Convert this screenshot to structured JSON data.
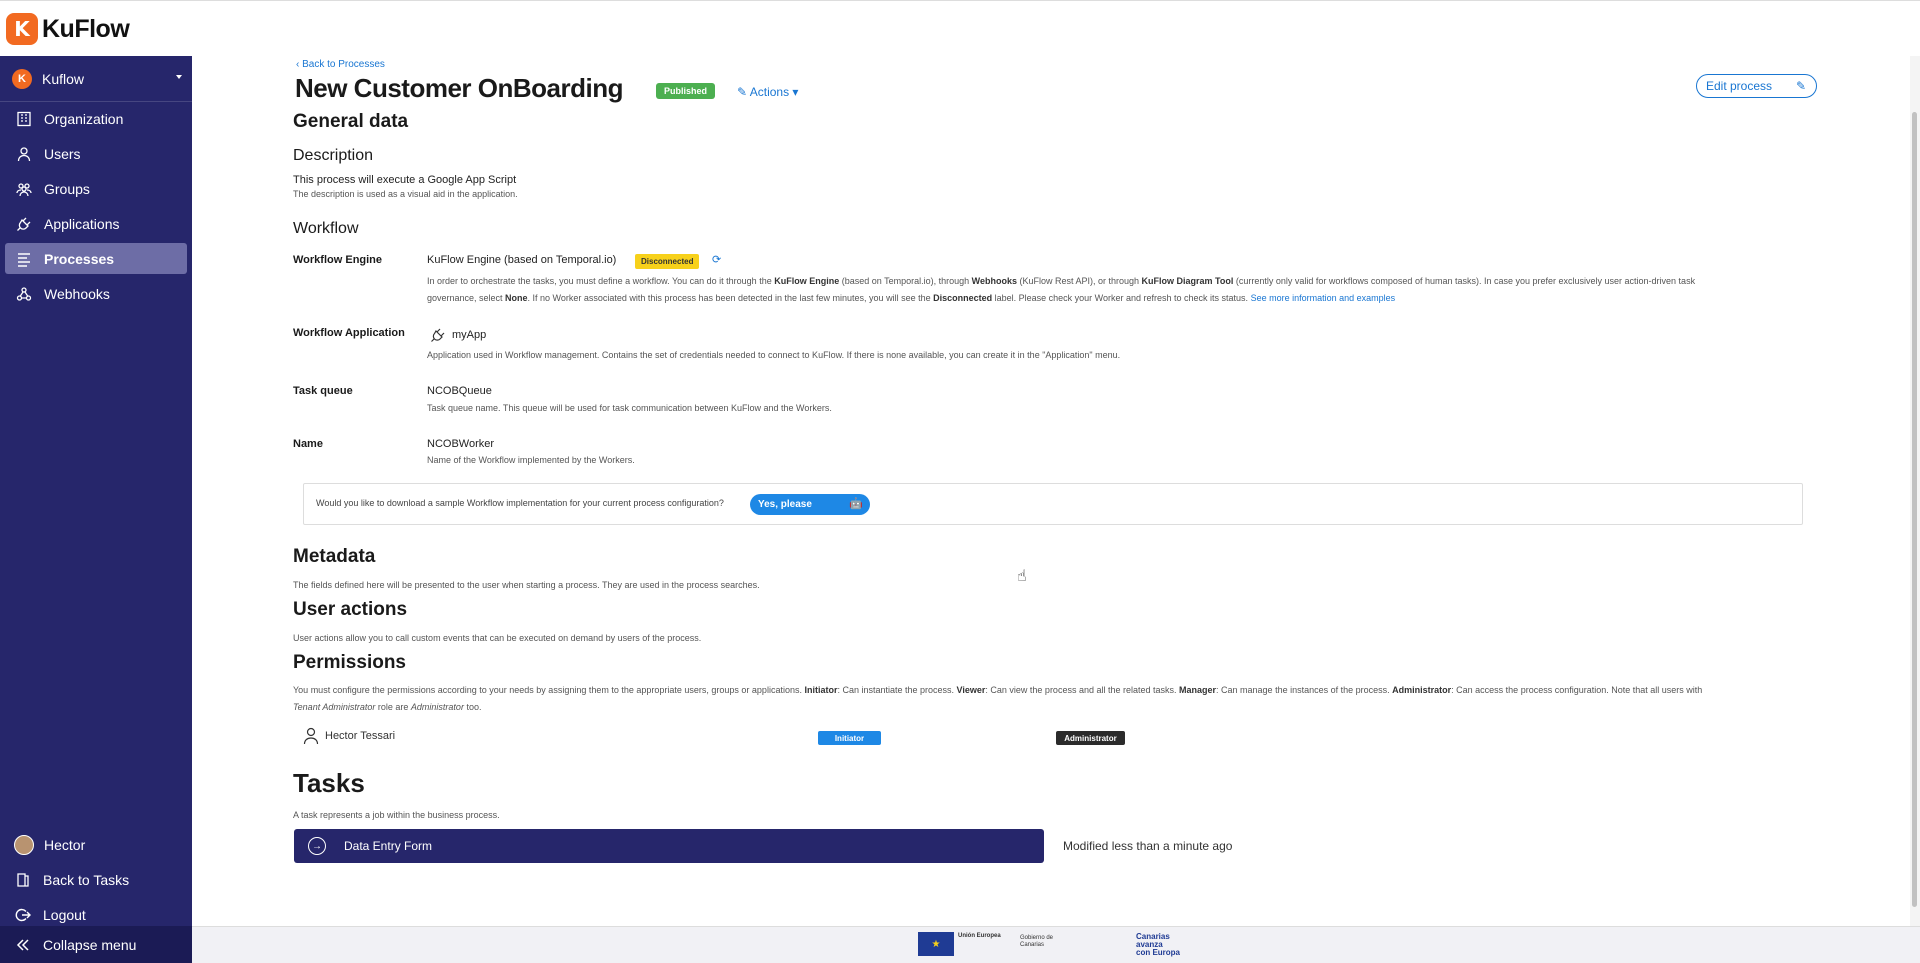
{
  "brand": {
    "logo_letter": "K",
    "name": "KuFlow"
  },
  "sidebar": {
    "tenant": {
      "initial": "K",
      "name": "Kuflow"
    },
    "items": [
      {
        "label": "Organization",
        "icon": "building-icon",
        "active": false
      },
      {
        "label": "Users",
        "icon": "user-icon",
        "active": false
      },
      {
        "label": "Groups",
        "icon": "groups-icon",
        "active": false
      },
      {
        "label": "Applications",
        "icon": "plug-icon",
        "active": false
      },
      {
        "label": "Processes",
        "icon": "list-icon",
        "active": true
      },
      {
        "label": "Webhooks",
        "icon": "webhook-icon",
        "active": false
      }
    ],
    "bottom": {
      "user": "Hector",
      "back_to_tasks": "Back to Tasks",
      "logout": "Logout",
      "collapse": "Collapse menu"
    }
  },
  "header": {
    "back_link": "Back to Processes",
    "title": "New Customer OnBoarding",
    "status": "Published",
    "actions": "Actions",
    "edit": "Edit process"
  },
  "general": {
    "heading": "General data",
    "description_heading": "Description",
    "description": "This process will execute a Google App Script",
    "description_hint": "The description is used as a visual aid in the application."
  },
  "workflow": {
    "heading": "Workflow",
    "engine_label": "Workflow Engine",
    "engine_value": "KuFlow Engine (based on Temporal.io)",
    "engine_status": "Disconnected",
    "engine_hint": {
      "p1": "In order to orchestrate the tasks, you must define a workflow. You can do it through the ",
      "b1": "KuFlow Engine",
      "p2": " (based on Temporal.io), through ",
      "b2": "Webhooks",
      "p3": " (KuFlow Rest API), or through ",
      "b3": "KuFlow Diagram Tool",
      "p4": " (currently only valid for workflows composed of human tasks). In case you prefer exclusively user action-driven task",
      "p5": "governance, select ",
      "b4": "None",
      "p6": ". If no Worker associated with this process has been detected in the last few minutes, you will see the ",
      "b5": "Disconnected",
      "p7": " label. Please check your Worker and refresh to check its status. ",
      "link": "See more information and examples"
    },
    "app_label": "Workflow Application",
    "app_value": "myApp",
    "app_hint": "Application used in Workflow management. Contains the set of credentials needed to connect to KuFlow. If there is none available, you can create it in the \"Application\" menu.",
    "queue_label": "Task queue",
    "queue_value": "NCOBQueue",
    "queue_hint": "Task queue name. This queue will be used for task communication between KuFlow and the Workers.",
    "name_label": "Name",
    "name_value": "NCOBWorker",
    "name_hint": "Name of the Workflow implemented by the Workers."
  },
  "download": {
    "question": "Would you like to download a sample Workflow implementation for your current process configuration?",
    "button": "Yes, please"
  },
  "metadata": {
    "heading": "Metadata",
    "hint": "The fields defined here will be presented to the user when starting a process. They are used in the process searches."
  },
  "user_actions": {
    "heading": "User actions",
    "hint": "User actions allow you to call custom events that can be executed on demand by users of the process."
  },
  "permissions": {
    "heading": "Permissions",
    "hint": {
      "p1": "You must configure the permissions according to your needs by assigning them to the appropriate users, groups or applications. ",
      "b1": "Initiator",
      "p2": ": Can instantiate the process. ",
      "b2": "Viewer",
      "p3": ": Can view the process and all the related tasks. ",
      "b3": "Manager",
      "p4": ": Can manage the instances of the process. ",
      "b4": "Administrator",
      "p5": ": Can access the process configuration. Note that all users with",
      "i1": "Tenant Administrator",
      "p6": " role are ",
      "i2": "Administrator",
      "p7": " too."
    },
    "rows": [
      {
        "name": "Hector Tessari",
        "role1": "Initiator",
        "role2": "Administrator"
      }
    ]
  },
  "tasks": {
    "heading": "Tasks",
    "hint": "A task represents a job within the business process.",
    "items": [
      {
        "name": "Data Entry Form",
        "modified": "Modified less than a minute ago"
      }
    ]
  },
  "footer": {
    "eu": "Unión Europea",
    "gov": "Gobierno de Canarias",
    "canarias_1": "Canarias",
    "canarias_2": "avanza",
    "canarias_3": "con Europa"
  }
}
